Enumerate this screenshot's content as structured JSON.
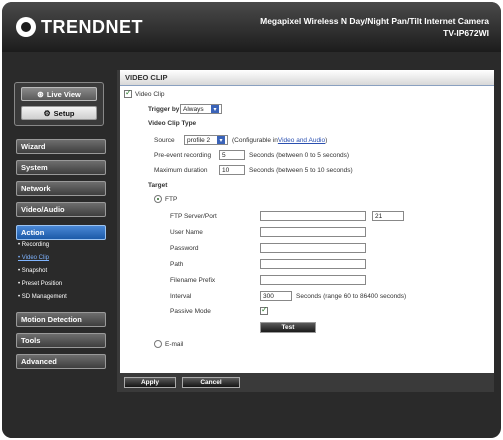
{
  "brand": {
    "name": "TRENDNET"
  },
  "product": {
    "title": "Megapixel Wireless N Day/Night Pan/Tilt Internet Camera",
    "model": "TV-IP672WI"
  },
  "nav": {
    "live_view": "Live View",
    "setup": "Setup",
    "menu": [
      {
        "label": "Wizard"
      },
      {
        "label": "System"
      },
      {
        "label": "Network"
      },
      {
        "label": "Video/Audio"
      },
      {
        "label": "Action"
      },
      {
        "label": "Motion Detection"
      },
      {
        "label": "Tools"
      },
      {
        "label": "Advanced"
      }
    ],
    "action_sub": [
      {
        "label": "• Recording"
      },
      {
        "label": "• Video Clip"
      },
      {
        "label": "• Snapshot"
      },
      {
        "label": "• Preset Position"
      },
      {
        "label": "• SD Management"
      }
    ]
  },
  "section": {
    "title": "VIDEO CLIP"
  },
  "form": {
    "video_clip_label": "Video Clip",
    "trigger_label": "Trigger by",
    "trigger_value": "Always",
    "clip_type_label": "Video Clip Type",
    "source_label": "Source",
    "source_value": "profile 2",
    "source_note_prefix": "(Configurable in ",
    "source_note_link": "Video and Audio",
    "source_note_suffix": ")",
    "pre_event_label": "Pre-event recording",
    "pre_event_value": "5",
    "pre_event_note": "Seconds (between 0 to 5 seconds)",
    "max_duration_label": "Maximum duration",
    "max_duration_value": "10",
    "max_duration_note": "Seconds (between 5 to 10 seconds)",
    "target_label": "Target",
    "ftp_label": "FTP",
    "ftp_server_port_label": "FTP Server/Port",
    "ftp_server_value": "",
    "ftp_port_value": "21",
    "user_name_label": "User Name",
    "password_label": "Password",
    "path_label": "Path",
    "filename_prefix_label": "Filename Prefix",
    "interval_label": "Interval",
    "interval_value": "300",
    "interval_note": "Seconds (range 60 to 86400 seconds)",
    "passive_mode_label": "Passive Mode",
    "test_label": "Test",
    "email_label": "E-mail"
  },
  "actions": {
    "apply": "Apply",
    "cancel": "Cancel"
  }
}
